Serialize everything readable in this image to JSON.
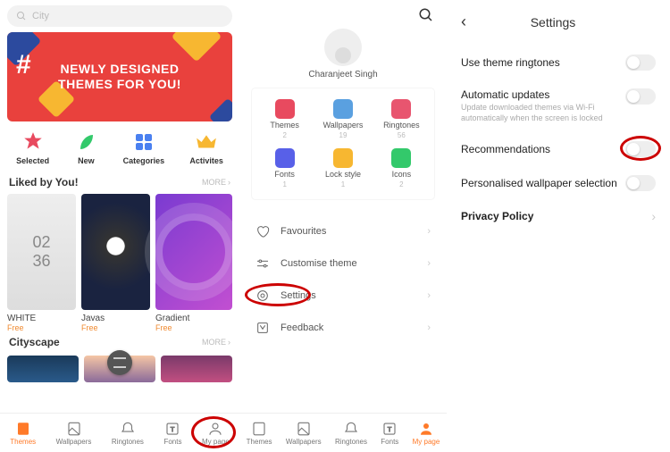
{
  "pane1": {
    "search_placeholder": "City",
    "hero_line1": "Newly Designed",
    "hero_line2": "Themes For You!",
    "quick": [
      {
        "label": "Selected"
      },
      {
        "label": "New"
      },
      {
        "label": "Categories"
      },
      {
        "label": "Activites"
      }
    ],
    "section1_title": "Liked by You!",
    "more_label": "MORE",
    "themes": [
      {
        "name": "WHITE",
        "price": "Free",
        "clock": "02\n36"
      },
      {
        "name": "Javas",
        "price": "Free"
      },
      {
        "name": "Gradient",
        "price": "Free"
      }
    ],
    "section2_title": "Cityscape",
    "bottomnav": [
      {
        "label": "Themes"
      },
      {
        "label": "Wallpapers"
      },
      {
        "label": "Ringtones"
      },
      {
        "label": "Fonts"
      },
      {
        "label": "My page"
      }
    ]
  },
  "pane2": {
    "username": "Charanjeet Singh",
    "stats": [
      {
        "label": "Themes",
        "count": "2",
        "color": "#e84a5f"
      },
      {
        "label": "Wallpapers",
        "count": "19",
        "color": "#5aa0e0"
      },
      {
        "label": "Ringtones",
        "count": "56",
        "color": "#e8556f"
      },
      {
        "label": "Fonts",
        "count": "1",
        "color": "#5860e8"
      },
      {
        "label": "Lock style",
        "count": "1",
        "color": "#f7b731"
      },
      {
        "label": "Icons",
        "count": "2",
        "color": "#33c96b"
      }
    ],
    "menu": [
      {
        "label": "Favourites"
      },
      {
        "label": "Customise theme"
      },
      {
        "label": "Settings"
      },
      {
        "label": "Feedback"
      }
    ],
    "bottomnav": [
      {
        "label": "Themes"
      },
      {
        "label": "Wallpapers"
      },
      {
        "label": "Ringtones"
      },
      {
        "label": "Fonts"
      },
      {
        "label": "My page"
      }
    ]
  },
  "pane3": {
    "title": "Settings",
    "rows": {
      "r0": {
        "label": "Use theme ringtones"
      },
      "r1": {
        "label": "Automatic updates",
        "sub": "Update downloaded themes via Wi-Fi automatically when the screen is locked"
      },
      "r2": {
        "label": "Recommendations"
      },
      "r3": {
        "label": "Personalised wallpaper selection"
      },
      "r4": {
        "label": "Privacy Policy"
      }
    }
  }
}
